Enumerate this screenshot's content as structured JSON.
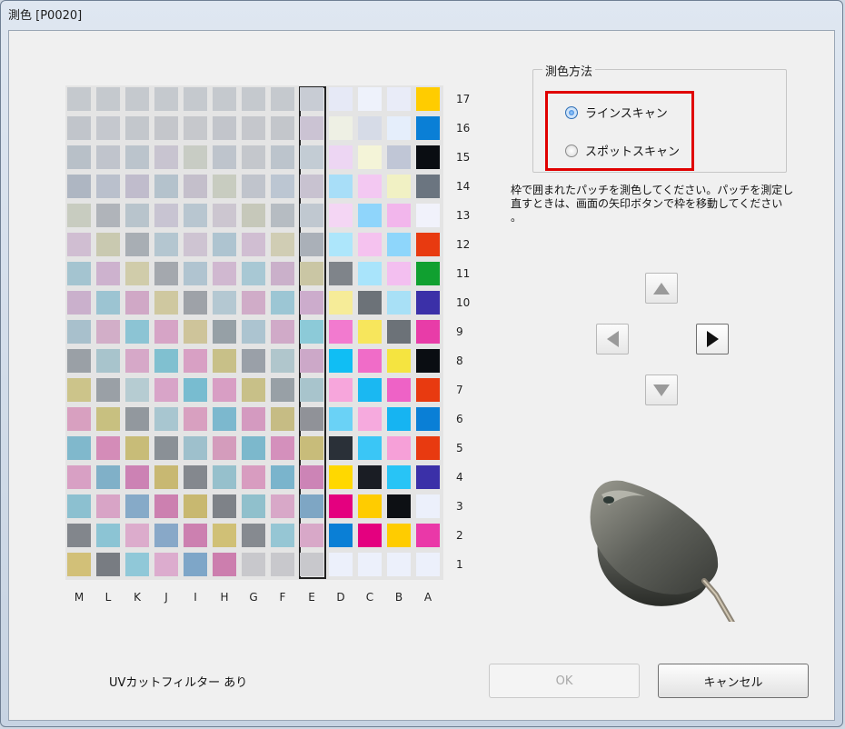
{
  "window": {
    "title": "測色 [P0020]"
  },
  "chart": {
    "columns": [
      "M",
      "L",
      "K",
      "J",
      "I",
      "H",
      "G",
      "F",
      "E",
      "D",
      "C",
      "B",
      "A"
    ],
    "rows": [
      "17",
      "16",
      "15",
      "14",
      "13",
      "12",
      "11",
      "10",
      "9",
      "8",
      "7",
      "6",
      "5",
      "4",
      "3",
      "2",
      "1"
    ],
    "selected_column": "E",
    "patch_colors": [
      [
        "#c5c9ce",
        "#c5c9ce",
        "#c5c9ce",
        "#c5c9ce",
        "#c5c9ce",
        "#c5c9ce",
        "#c5c9ce",
        "#c5c9ce",
        "#c8ccd4",
        "#e6e9f6",
        "#eef2fb",
        "#e9ecf8",
        "#ffcc00"
      ],
      [
        "#c1c5cb",
        "#c5c8ce",
        "#c3c7cc",
        "#c4c6cb",
        "#c6c8cc",
        "#c2c5cb",
        "#c5c7cc",
        "#c3c6cb",
        "#cbc3d3",
        "#eef0e4",
        "#d6dbe7",
        "#e5eefb",
        "#0a7fd6"
      ],
      [
        "#b8c0c8",
        "#c0c4cc",
        "#bbc4cc",
        "#c8c4d0",
        "#c8ccc4",
        "#bec4cc",
        "#c4c7cc",
        "#bcc4cc",
        "#c3ccd4",
        "#edd6f3",
        "#f4f4d8",
        "#c0c6d6",
        "#0a0d12"
      ],
      [
        "#aeb6c2",
        "#bac0cc",
        "#c0bccc",
        "#b4c2cc",
        "#c4bfcb",
        "#c8ccc0",
        "#c0c4cc",
        "#bcc6d2",
        "#c8c2d0",
        "#a8def8",
        "#f3c8f2",
        "#f1f1c4",
        "#6b7580"
      ],
      [
        "#c8ccc0",
        "#b0b4ba",
        "#b8c4cc",
        "#c8c4d2",
        "#b8c6d0",
        "#ccc6d0",
        "#c6c8ba",
        "#b6bcc2",
        "#c0c8d0",
        "#f4d6f4",
        "#8fd5fb",
        "#f2b6ec",
        "#f1f2fb"
      ],
      [
        "#d0bed2",
        "#c9c9b0",
        "#a8aeb4",
        "#b4c6d0",
        "#cec4d2",
        "#aec4d0",
        "#d0bed2",
        "#d0cdb4",
        "#aab0b8",
        "#ade6fb",
        "#f5c2ef",
        "#8ed6fb",
        "#e83a10"
      ],
      [
        "#a4c4d0",
        "#cdb2ce",
        "#d0ccaa",
        "#a4a8ae",
        "#b0c4d0",
        "#d0b8d0",
        "#a8c8d4",
        "#cab0ca",
        "#cac6a4",
        "#7f848a",
        "#a9e4fb",
        "#f3bff0",
        "#10a030"
      ],
      [
        "#cab0cc",
        "#9cc4d2",
        "#d0a8c6",
        "#cfc8a0",
        "#9ea2a8",
        "#b4c8d2",
        "#d0acc8",
        "#9cc6d4",
        "#ccaccc",
        "#f6ec98",
        "#6c7278",
        "#a8e0f6",
        "#3b30a8"
      ],
      [
        "#a8c0cc",
        "#d2aec8",
        "#8cc4d4",
        "#d6a4c6",
        "#cec49a",
        "#96a0a6",
        "#acc4d0",
        "#d0aac8",
        "#8ccad8",
        "#f27acf",
        "#f7e65c",
        "#6c7278",
        "#e83ca8"
      ],
      [
        "#9aa0a6",
        "#a8c4cc",
        "#d6a8c8",
        "#80c0d0",
        "#d8a0c4",
        "#c8c088",
        "#9aa0a8",
        "#b0c6cc",
        "#cca8c8",
        "#10bef4",
        "#f06cc8",
        "#f5e440",
        "#0a0d12"
      ],
      [
        "#ccc48a",
        "#9aa0a6",
        "#b6ccd2",
        "#d8a4c8",
        "#78bcd0",
        "#d89ec4",
        "#c8c088",
        "#98a0a6",
        "#a8c4cc",
        "#f7a6dc",
        "#1ab8f2",
        "#ee62c6",
        "#e83a10"
      ],
      [
        "#d8a0c0",
        "#c8c080",
        "#92989e",
        "#a8c6d0",
        "#d8a0c0",
        "#7cb8ce",
        "#d49ac0",
        "#c6bc84",
        "#909298",
        "#6ad2f6",
        "#f6aade",
        "#16b4f2",
        "#0a7fd6"
      ],
      [
        "#80b8cc",
        "#d48cb8",
        "#c8bc78",
        "#8a9096",
        "#9ec0cc",
        "#d49cbc",
        "#7cb8cc",
        "#d490bc",
        "#c8bc7a",
        "#2a3038",
        "#3ac6f6",
        "#f6a0d8",
        "#e83a10"
      ],
      [
        "#d8a0c4",
        "#80b0c8",
        "#cc82b4",
        "#c8b872",
        "#84888e",
        "#96c0cc",
        "#d89cc0",
        "#7ab4cc",
        "#cc84b6",
        "#ffd800",
        "#1a1d24",
        "#28c4f6",
        "#3b30a8"
      ],
      [
        "#8cc0d0",
        "#d8a4c6",
        "#86aac8",
        "#cc80b0",
        "#c8b870",
        "#7e8288",
        "#90c0cc",
        "#d8a8c8",
        "#7ea6c4",
        "#e4007f",
        "#ffcc00",
        "#0d1014",
        "#ecf0fb"
      ],
      [
        "#82868c",
        "#8cc4d4",
        "#dcaccc",
        "#88a8c8",
        "#cc80b0",
        "#d0c076",
        "#868a90",
        "#96c6d4",
        "#d8a8c8",
        "#0a7fd6",
        "#e4007f",
        "#ffcc00",
        "#ea38a8"
      ],
      [
        "#d2c078",
        "#787c82",
        "#90c8d8",
        "#dcacce",
        "#7ea6c8",
        "#cc7eae",
        "#c8c8cc",
        "#c8c8cc",
        "#c8c8cc",
        "#ecf0fb",
        "#ecf0fb",
        "#ecf0fb",
        "#ecf0fb"
      ]
    ]
  },
  "method_group": {
    "title": "測色方法",
    "options": [
      {
        "label": "ラインスキャン",
        "checked": true
      },
      {
        "label": "スポットスキャン",
        "checked": false
      }
    ]
  },
  "instruction": {
    "line1": "枠で囲まれたパッチを測色してください。パッチを測定し",
    "line2": "直すときは、画面の矢印ボタンで枠を移動してください",
    "line3": "。"
  },
  "uv_filter_label": "UVカットフィルター  あり",
  "buttons": {
    "ok": "OK",
    "cancel": "キャンセル"
  },
  "colors": {
    "highlight": "#e00000",
    "ok_disabled_text": "#a8a8a8",
    "radio_selected": "#1f6fd1"
  }
}
